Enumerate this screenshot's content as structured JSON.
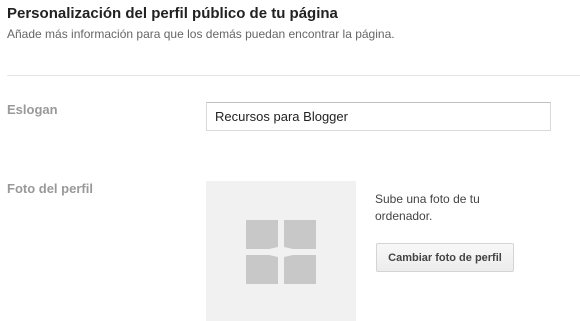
{
  "header": {
    "title": "Personalización del perfil público de tu página",
    "subtitle": "Añade más información para que los demás puedan encontrar la página."
  },
  "slogan": {
    "label": "Eslogan",
    "value": "Recursos para Blogger"
  },
  "profile_photo": {
    "label": "Foto del perfil",
    "placeholder_icon": "image-placeholder-icon",
    "hint": "Sube una foto de tu ordenador.",
    "button_label": "Cambiar foto de perfil"
  },
  "colors": {
    "title": "#222222",
    "subtitle": "#666666",
    "field_label": "#999999",
    "photo_background": "#f1f1f1",
    "placeholder_icon": "#c8c8c8"
  }
}
